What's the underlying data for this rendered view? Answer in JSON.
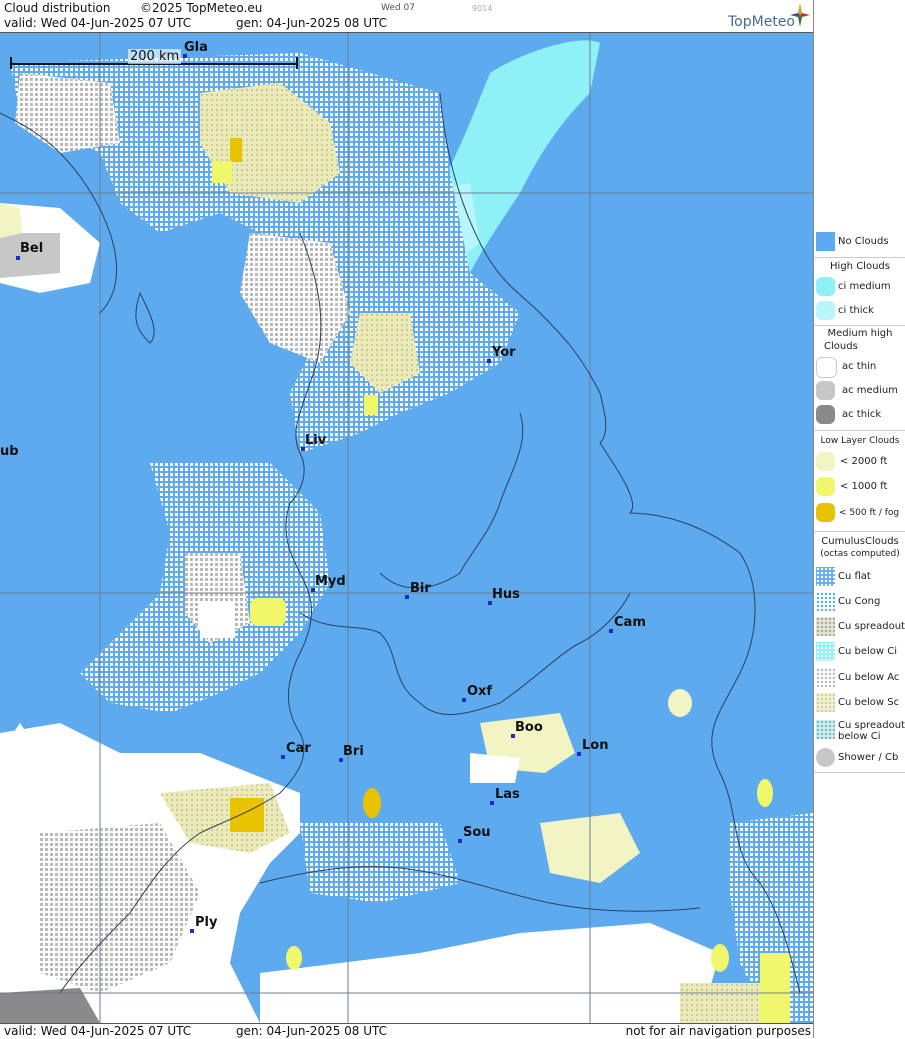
{
  "header": {
    "title": "Cloud distribution",
    "copyright": "©2025 TopMeteo.eu",
    "day_code": "Wed 07",
    "small_code": "9014",
    "valid_line": "valid:  Wed  04-Jun-2025  07 UTC",
    "gen_line": "gen: 04-Jun-2025 08 UTC",
    "logo": "TopMeteo"
  },
  "map": {
    "scale_label": "200 km",
    "cities": [
      {
        "name": "Gla"
      },
      {
        "name": "Bel"
      },
      {
        "name": "Yor"
      },
      {
        "name": "Liv"
      },
      {
        "name": "ub"
      },
      {
        "name": "Myd"
      },
      {
        "name": "Bir"
      },
      {
        "name": "Hus"
      },
      {
        "name": "Cam"
      },
      {
        "name": "Oxf"
      },
      {
        "name": "Boo"
      },
      {
        "name": "Lon"
      },
      {
        "name": "Car"
      },
      {
        "name": "Bri"
      },
      {
        "name": "Las"
      },
      {
        "name": "Sou"
      },
      {
        "name": "Ply"
      }
    ],
    "colors": {
      "no_clouds": "#5eaaee",
      "ci_medium": "#8ef1f8",
      "ci_thick": "#b8f6fb",
      "ac_thin": "#ffffff",
      "ac_medium": "#c7c7c7",
      "ac_thick": "#8a8a8a",
      "low_2000": "#f2f4c4",
      "low_1000": "#f0f76a",
      "low_500": "#e9c200"
    }
  },
  "footer": {
    "valid_line": "valid:  Wed  04-Jun-2025  07 UTC",
    "gen_line": "gen: 04-Jun-2025 08 UTC",
    "disclaimer": "not for air navigation purposes"
  },
  "legend": {
    "no_clouds": "No Clouds",
    "high_head": "High Clouds",
    "ci_medium": "ci medium",
    "ci_thick": "ci thick",
    "medium_head_1": "Medium high",
    "medium_head_2": "Clouds",
    "ac_thin": "ac thin",
    "ac_medium": "ac medium",
    "ac_thick": "ac thick",
    "low_head": "Low Layer Clouds",
    "low_2000": "< 2000 ft",
    "low_1000": "< 1000 ft",
    "low_500": "< 500 ft / fog",
    "cu_head": "CumulusClouds",
    "cu_sub": "(octas computed)",
    "cu_flat": "Cu flat",
    "cu_cong": "Cu Cong",
    "cu_spread": "Cu spreadout",
    "cu_below_ci": "Cu below Ci",
    "cu_below_ac": "Cu below Ac",
    "cu_below_sc": "Cu below Sc",
    "cu_spread_ci_1": "Cu spreadout",
    "cu_spread_ci_2": "below Ci",
    "shower": "Shower / Cb"
  }
}
